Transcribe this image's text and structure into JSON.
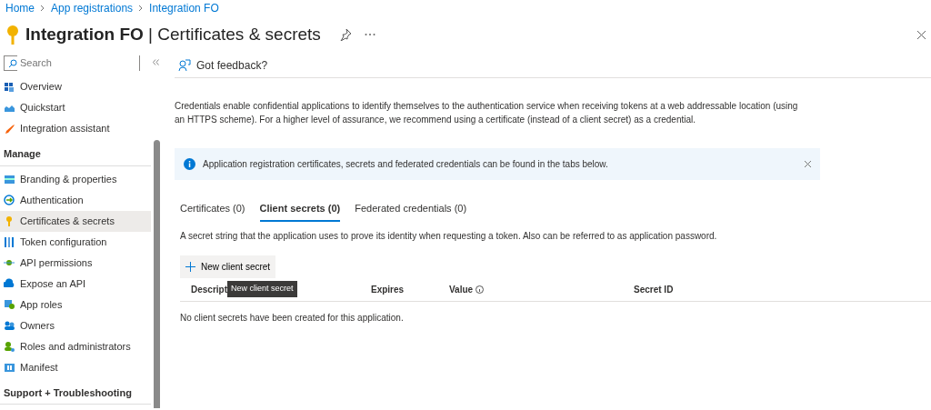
{
  "breadcrumb": [
    "Home",
    "App registrations",
    "Integration FO"
  ],
  "page_title": {
    "resource": "Integration FO",
    "separator": "|",
    "blade": "Certificates & secrets"
  },
  "sidebar": {
    "search": {
      "placeholder": "Search"
    },
    "sections": [
      {
        "items": [
          {
            "label": "Overview",
            "selected": false
          },
          {
            "label": "Quickstart",
            "selected": false
          },
          {
            "label": "Integration assistant",
            "selected": false
          }
        ]
      },
      {
        "heading": "Manage",
        "items": [
          {
            "label": "Branding & properties",
            "selected": false
          },
          {
            "label": "Authentication",
            "selected": false
          },
          {
            "label": "Certificates & secrets",
            "selected": true
          },
          {
            "label": "Token configuration",
            "selected": false
          },
          {
            "label": "API permissions",
            "selected": false
          },
          {
            "label": "Expose an API",
            "selected": false
          },
          {
            "label": "App roles",
            "selected": false
          },
          {
            "label": "Owners",
            "selected": false
          },
          {
            "label": "Roles and administrators",
            "selected": false
          },
          {
            "label": "Manifest",
            "selected": false
          }
        ]
      },
      {
        "heading": "Support + Troubleshooting"
      }
    ]
  },
  "toolbar": {
    "feedback": "Got feedback?"
  },
  "intro": "Credentials enable confidential applications to identify themselves to the authentication service when receiving tokens at a web addressable location (using an HTTPS scheme). For a higher level of assurance, we recommend using a certificate (instead of a client secret) as a credential.",
  "info_banner": "Application registration certificates, secrets and federated credentials can be found in the tabs below.",
  "tabs": [
    {
      "label": "Certificates (0)",
      "selected": false
    },
    {
      "label": "Client secrets (0)",
      "selected": true
    },
    {
      "label": "Federated credentials (0)",
      "selected": false
    }
  ],
  "tab_description": "A secret string that the application uses to prove its identity when requesting a token. Also can be referred to as application password.",
  "new_button": "New client secret",
  "tooltip": "New client secret",
  "table": {
    "columns": [
      {
        "label": "Descript",
        "kind": "plain"
      },
      {
        "label": "Expires",
        "kind": "plain"
      },
      {
        "label": "Value",
        "kind": "info"
      },
      {
        "label": "Secret ID",
        "kind": "plain"
      }
    ],
    "empty_message": "No client secrets have been created for this application."
  }
}
